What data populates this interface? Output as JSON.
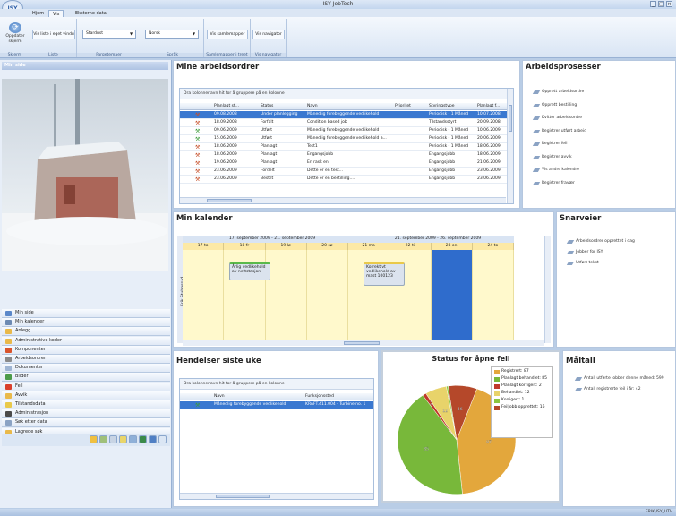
{
  "app": {
    "title": "ISY JobTech",
    "logo": "ISY"
  },
  "menu": {
    "tabs": [
      "Hjem",
      "Vis",
      "Eksterne data"
    ],
    "active": "Vis"
  },
  "ribbon": {
    "refresh_label": "Oppdater skjerm",
    "groups": [
      "Skjerm",
      "Liste",
      "Fargetemaer",
      "Språk",
      "Samlemapper i treet",
      "Vis navigator"
    ],
    "list_button": "Vis liste i eget vindu",
    "theme_value": "Stardust",
    "lang_value": "Norsk",
    "folders_button": "Vis samlemapper",
    "navigator_button": "Vis navigator"
  },
  "left": {
    "header": "Min side",
    "nav": [
      {
        "label": "Min side",
        "color": "#5a87c9"
      },
      {
        "label": "Min kalender",
        "color": "#6c8ab3"
      },
      {
        "label": "Anlegg",
        "color": "#e9b94a"
      },
      {
        "label": "Administrative koder",
        "color": "#e9b94a"
      },
      {
        "label": "Komponenter",
        "color": "#d9542c"
      },
      {
        "label": "Arbeidsordrer",
        "color": "#8a8a8a"
      },
      {
        "label": "Dokumenter",
        "color": "#9fb5d3"
      },
      {
        "label": "Bilder",
        "color": "#4c9b4a"
      },
      {
        "label": "Feil",
        "color": "#d9402c"
      },
      {
        "label": "Avvik",
        "color": "#e9b94a"
      },
      {
        "label": "Tilstandsdata",
        "color": "#e9c94a"
      },
      {
        "label": "Administrasjon",
        "color": "#4a4a4a"
      },
      {
        "label": "Søk etter data",
        "color": "#8ba3c4"
      },
      {
        "label": "Lagrede søk",
        "color": "#e9b94a"
      }
    ]
  },
  "workorders": {
    "title": "Mine arbeidsordrer",
    "drag_hint": "Dra kolonnenavn hit for å gruppere på en kolonne",
    "columns": [
      "Planlagt st...",
      "Status",
      "Navn",
      "Prioritet",
      "Styringstype",
      "Planlagt f..."
    ],
    "rows": [
      [
        "09.08.2008",
        "Under planlegging",
        "Månedlig forebyggende vedlikehold",
        "",
        "Periodisk - 1 Måned",
        "10.07.2008"
      ],
      [
        "18.09.2008",
        "Forfalt",
        "Condition based job",
        "",
        "Tilstandsstyrt",
        "20.09.2008"
      ],
      [
        "09.06.2009",
        "Utført",
        "Månedlig forebyggende vedlikehold",
        "",
        "Periodisk - 1 Måned",
        "10.06.2009"
      ],
      [
        "15.06.2009",
        "Utført",
        "Månedlig forebyggende vedlikehold a...",
        "",
        "Periodisk - 1 Måned",
        "20.06.2009"
      ],
      [
        "18.06.2009",
        "Planlagt",
        "Test1",
        "",
        "Periodisk - 1 Måned",
        "18.06.2009"
      ],
      [
        "18.06.2009",
        "Planlagt",
        "Engangsjobb",
        "",
        "Engangsjobb",
        "18.06.2009"
      ],
      [
        "19.06.2009",
        "Planlagt",
        "En rask en",
        "",
        "Engangsjobb",
        "21.06.2009"
      ],
      [
        "23.06.2009",
        "Fordelt",
        "Dette er en test...",
        "",
        "Engangsjobb",
        "23.06.2009"
      ],
      [
        "23.06.2009",
        "Bestilt",
        "Dette er en bestilling....",
        "",
        "Engangsjobb",
        "23.06.2009"
      ]
    ]
  },
  "processes": {
    "title": "Arbeidsprosesser",
    "items": [
      "Opprett arbeidsordre",
      "Opprett bestilling",
      "Kvitter arbeidsordre",
      "Registrer utført arbeid",
      "Registrer feil",
      "Registrer avvik",
      "Vis andre kalendre",
      "Registrer fravær"
    ]
  },
  "calendar": {
    "title": "Min kalender",
    "week1": "17. september 2009 - 21. september 2009",
    "week2": "21. september 2009 - 26. september 2009",
    "days": [
      "17 to",
      "18 fr",
      "19 lø",
      "20 sø",
      "21 ma",
      "22 ti",
      "23 on",
      "24 to"
    ],
    "resource": "Erik Stubbsrud",
    "appts": [
      "Årlig vedlikehold av nettstasjon",
      "Korrektivt vedlikehold av mast 100123"
    ]
  },
  "shortcuts": {
    "title": "Snarveier",
    "items": [
      "Arbeidsordrer opprettet i dag",
      "Jobber for ISY",
      "Utført tekst"
    ]
  },
  "events": {
    "title": "Hendelser siste uke",
    "drag_hint": "Dra kolonnenavn hit for å gruppere på en kolonne",
    "columns": [
      "Navn",
      "Funksjonssted"
    ],
    "row": [
      "Månedlig forebyggende vedlikehold",
      "KRAFT.411.004 - Turbine no. 1"
    ]
  },
  "chart_data": {
    "type": "pie",
    "title": "Status for åpne feil",
    "categories": [
      "Registrert",
      "Planlagt behandlet",
      "Planlagt korrigert",
      "Behandlet",
      "Korrigert",
      "Feiljobb opprettet"
    ],
    "legend_labels": [
      "Registrert: 87",
      "Planlagt behandlet: 85",
      "Planlagt korrigert: 2",
      "Behandlet: 12",
      "Korrigert: 1",
      "Feiljobb opprettet: 16"
    ],
    "values": [
      87,
      85,
      2,
      12,
      1,
      16
    ],
    "colors": [
      "#e3a73c",
      "#78b83a",
      "#c0392b",
      "#e8d36a",
      "#8dc63f",
      "#b5482a"
    ],
    "slice_labels": [
      "87",
      "85",
      "2",
      "12",
      "1",
      "16"
    ],
    "legend": "right"
  },
  "metrics": {
    "title": "Måltall",
    "items": [
      "Antall utførte jobber denne måned: 599",
      "Antall registrerte feil i år: 42"
    ]
  },
  "status": {
    "text": "ERIK\\ISY_UTV"
  }
}
